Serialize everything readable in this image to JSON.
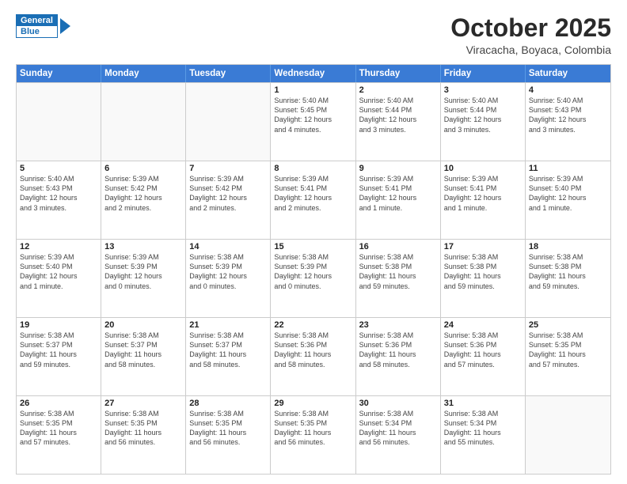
{
  "header": {
    "logo_line1": "General",
    "logo_line2": "Blue",
    "month_title": "October 2025",
    "location": "Viracacha, Boyaca, Colombia"
  },
  "days_of_week": [
    "Sunday",
    "Monday",
    "Tuesday",
    "Wednesday",
    "Thursday",
    "Friday",
    "Saturday"
  ],
  "weeks": [
    [
      {
        "day": "",
        "info": ""
      },
      {
        "day": "",
        "info": ""
      },
      {
        "day": "",
        "info": ""
      },
      {
        "day": "1",
        "info": "Sunrise: 5:40 AM\nSunset: 5:45 PM\nDaylight: 12 hours\nand 4 minutes."
      },
      {
        "day": "2",
        "info": "Sunrise: 5:40 AM\nSunset: 5:44 PM\nDaylight: 12 hours\nand 3 minutes."
      },
      {
        "day": "3",
        "info": "Sunrise: 5:40 AM\nSunset: 5:44 PM\nDaylight: 12 hours\nand 3 minutes."
      },
      {
        "day": "4",
        "info": "Sunrise: 5:40 AM\nSunset: 5:43 PM\nDaylight: 12 hours\nand 3 minutes."
      }
    ],
    [
      {
        "day": "5",
        "info": "Sunrise: 5:40 AM\nSunset: 5:43 PM\nDaylight: 12 hours\nand 3 minutes."
      },
      {
        "day": "6",
        "info": "Sunrise: 5:39 AM\nSunset: 5:42 PM\nDaylight: 12 hours\nand 2 minutes."
      },
      {
        "day": "7",
        "info": "Sunrise: 5:39 AM\nSunset: 5:42 PM\nDaylight: 12 hours\nand 2 minutes."
      },
      {
        "day": "8",
        "info": "Sunrise: 5:39 AM\nSunset: 5:41 PM\nDaylight: 12 hours\nand 2 minutes."
      },
      {
        "day": "9",
        "info": "Sunrise: 5:39 AM\nSunset: 5:41 PM\nDaylight: 12 hours\nand 1 minute."
      },
      {
        "day": "10",
        "info": "Sunrise: 5:39 AM\nSunset: 5:41 PM\nDaylight: 12 hours\nand 1 minute."
      },
      {
        "day": "11",
        "info": "Sunrise: 5:39 AM\nSunset: 5:40 PM\nDaylight: 12 hours\nand 1 minute."
      }
    ],
    [
      {
        "day": "12",
        "info": "Sunrise: 5:39 AM\nSunset: 5:40 PM\nDaylight: 12 hours\nand 1 minute."
      },
      {
        "day": "13",
        "info": "Sunrise: 5:39 AM\nSunset: 5:39 PM\nDaylight: 12 hours\nand 0 minutes."
      },
      {
        "day": "14",
        "info": "Sunrise: 5:38 AM\nSunset: 5:39 PM\nDaylight: 12 hours\nand 0 minutes."
      },
      {
        "day": "15",
        "info": "Sunrise: 5:38 AM\nSunset: 5:39 PM\nDaylight: 12 hours\nand 0 minutes."
      },
      {
        "day": "16",
        "info": "Sunrise: 5:38 AM\nSunset: 5:38 PM\nDaylight: 11 hours\nand 59 minutes."
      },
      {
        "day": "17",
        "info": "Sunrise: 5:38 AM\nSunset: 5:38 PM\nDaylight: 11 hours\nand 59 minutes."
      },
      {
        "day": "18",
        "info": "Sunrise: 5:38 AM\nSunset: 5:38 PM\nDaylight: 11 hours\nand 59 minutes."
      }
    ],
    [
      {
        "day": "19",
        "info": "Sunrise: 5:38 AM\nSunset: 5:37 PM\nDaylight: 11 hours\nand 59 minutes."
      },
      {
        "day": "20",
        "info": "Sunrise: 5:38 AM\nSunset: 5:37 PM\nDaylight: 11 hours\nand 58 minutes."
      },
      {
        "day": "21",
        "info": "Sunrise: 5:38 AM\nSunset: 5:37 PM\nDaylight: 11 hours\nand 58 minutes."
      },
      {
        "day": "22",
        "info": "Sunrise: 5:38 AM\nSunset: 5:36 PM\nDaylight: 11 hours\nand 58 minutes."
      },
      {
        "day": "23",
        "info": "Sunrise: 5:38 AM\nSunset: 5:36 PM\nDaylight: 11 hours\nand 58 minutes."
      },
      {
        "day": "24",
        "info": "Sunrise: 5:38 AM\nSunset: 5:36 PM\nDaylight: 11 hours\nand 57 minutes."
      },
      {
        "day": "25",
        "info": "Sunrise: 5:38 AM\nSunset: 5:35 PM\nDaylight: 11 hours\nand 57 minutes."
      }
    ],
    [
      {
        "day": "26",
        "info": "Sunrise: 5:38 AM\nSunset: 5:35 PM\nDaylight: 11 hours\nand 57 minutes."
      },
      {
        "day": "27",
        "info": "Sunrise: 5:38 AM\nSunset: 5:35 PM\nDaylight: 11 hours\nand 56 minutes."
      },
      {
        "day": "28",
        "info": "Sunrise: 5:38 AM\nSunset: 5:35 PM\nDaylight: 11 hours\nand 56 minutes."
      },
      {
        "day": "29",
        "info": "Sunrise: 5:38 AM\nSunset: 5:35 PM\nDaylight: 11 hours\nand 56 minutes."
      },
      {
        "day": "30",
        "info": "Sunrise: 5:38 AM\nSunset: 5:34 PM\nDaylight: 11 hours\nand 56 minutes."
      },
      {
        "day": "31",
        "info": "Sunrise: 5:38 AM\nSunset: 5:34 PM\nDaylight: 11 hours\nand 55 minutes."
      },
      {
        "day": "",
        "info": ""
      }
    ]
  ]
}
